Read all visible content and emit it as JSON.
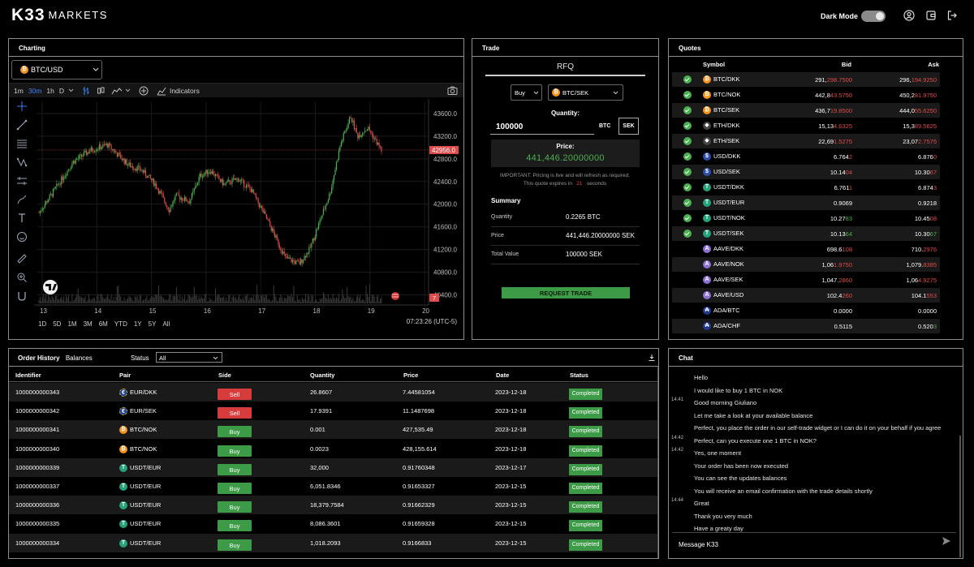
{
  "header": {
    "logo_mark": "K33",
    "logo_word": "MARKETS",
    "dark_mode_label": "Dark Mode",
    "dark_mode_on": true
  },
  "charting": {
    "title": "Charting",
    "pair": "BTC/USD",
    "intervals": [
      "1m",
      "30m",
      "1h",
      "D"
    ],
    "active_interval": "30m",
    "indicators_label": "Indicators",
    "y_ticks": [
      "43600.0",
      "43200.0",
      "42800.0",
      "42400.0",
      "42000.0",
      "41600.0",
      "41200.0",
      "40800.0",
      "40400.0"
    ],
    "x_ticks": [
      "13",
      "14",
      "15",
      "16",
      "17",
      "18",
      "19",
      "20"
    ],
    "current_price": "42956.0",
    "small_marker": "7",
    "ranges": [
      "1D",
      "5D",
      "1M",
      "3M",
      "6M",
      "YTD",
      "1Y",
      "5Y",
      "All"
    ],
    "clock": "07:23:26 (UTC-5)",
    "colors": {
      "up": "#4caf50",
      "down": "#e04b4b",
      "price_tag": "#e04b4b"
    }
  },
  "trade": {
    "title": "Trade",
    "tab": "RFQ",
    "side": "Buy",
    "pair": "BTC/SEK",
    "quantity_label": "Quantity:",
    "quantity": "100000",
    "unit_btc": "BTC",
    "unit_sek": "SEK",
    "price_label": "Price:",
    "price": "441,446.20000000",
    "note_line1": "IMPORTANT: Pricing is live and will refresh as required.",
    "note_prefix": "This quote expires in",
    "expires_seconds": "21",
    "note_suffix": "seconds",
    "summary_title": "Summary",
    "summary": [
      {
        "label": "Quantity",
        "value": "0.2265 BTC"
      },
      {
        "label": "Price",
        "value": "441,446.20000000 SEK"
      },
      {
        "label": "Total Value",
        "value": "100000 SEK"
      }
    ],
    "request_button": "REQUEST TRADE"
  },
  "quotes": {
    "title": "Quotes",
    "headers": {
      "symbol": "Symbol",
      "bid": "Bid",
      "ask": "Ask"
    },
    "rows": [
      {
        "check": true,
        "icon": "btc",
        "symbol": "BTC/DKK",
        "bid_a": "291,",
        "bid_b": "298.7500",
        "bid_c": "hl",
        "ask_a": "296,",
        "ask_b": "194.9250",
        "ask_c": "hl"
      },
      {
        "check": true,
        "icon": "btc",
        "symbol": "BTC/NOK",
        "bid_a": "442,8",
        "bid_b": "43.5750",
        "bid_c": "hl",
        "ask_a": "450,2",
        "ask_b": "81.9750",
        "ask_c": "hl"
      },
      {
        "check": true,
        "icon": "btc",
        "symbol": "BTC/SEK",
        "bid_a": "436,7",
        "bid_b": "19.8500",
        "bid_c": "hl",
        "ask_a": "444,0",
        "ask_b": "55.6250",
        "ask_c": "hl"
      },
      {
        "check": true,
        "icon": "eth",
        "symbol": "ETH/DKK",
        "bid_a": "15,13",
        "bid_b": "4.6325",
        "bid_c": "hl",
        "ask_a": "15,3",
        "ask_b": "89.5625",
        "ask_c": "hl"
      },
      {
        "check": true,
        "icon": "eth",
        "symbol": "ETH/SEK",
        "bid_a": "22,69",
        "bid_b": "1.5275",
        "bid_c": "hl",
        "ask_a": "23,07",
        "ask_b": "2.7575",
        "ask_c": "hl"
      },
      {
        "check": true,
        "icon": "usd",
        "symbol": "USD/DKK",
        "bid_a": "6.764",
        "bid_b": "2",
        "bid_c": "hl",
        "ask_a": "6.876",
        "ask_b": "0",
        "ask_c": "hl"
      },
      {
        "check": true,
        "icon": "usd",
        "symbol": "USD/SEK",
        "bid_a": "10.14",
        "bid_b": "04",
        "bid_c": "hl",
        "ask_a": "10.30",
        "ask_b": "67",
        "ask_c": "hl"
      },
      {
        "check": true,
        "icon": "usdt",
        "symbol": "USDT/DKK",
        "bid_a": "6.761",
        "bid_b": "1",
        "bid_c": "hl",
        "ask_a": "6.874",
        "ask_b": "3",
        "ask_c": "hl"
      },
      {
        "check": true,
        "icon": "usdt",
        "symbol": "USDT/EUR",
        "bid_a": "0.9069",
        "bid_b": "",
        "bid_c": "",
        "ask_a": "0.9218",
        "ask_b": "",
        "ask_c": ""
      },
      {
        "check": true,
        "icon": "usdt",
        "symbol": "USDT/NOK",
        "bid_a": "10.27",
        "bid_b": "83",
        "bid_c": "hg",
        "ask_a": "10.45",
        "ask_b": "08",
        "ask_c": "hl"
      },
      {
        "check": true,
        "icon": "usdt",
        "symbol": "USDT/SEK",
        "bid_a": "10.13",
        "bid_b": "64",
        "bid_c": "hg",
        "ask_a": "10.30",
        "ask_b": "67",
        "ask_c": "hg"
      },
      {
        "check": false,
        "icon": "aave",
        "symbol": "AAVE/DKK",
        "bid_a": "698.6",
        "bid_b": "108",
        "bid_c": "hl",
        "ask_a": "710.",
        "ask_b": "2976",
        "ask_c": "hl"
      },
      {
        "check": false,
        "icon": "aave",
        "symbol": "AAVE/NOK",
        "bid_a": "1,06",
        "bid_b": "1.9750",
        "bid_c": "hl",
        "ask_a": "1,079.",
        "ask_b": "8385",
        "ask_c": "hl"
      },
      {
        "check": false,
        "icon": "aave",
        "symbol": "AAVE/SEK",
        "bid_a": "1,047.",
        "bid_b": "2860",
        "bid_c": "hl",
        "ask_a": "1,06",
        "ask_b": "4.9275",
        "ask_c": "hl"
      },
      {
        "check": false,
        "icon": "aave",
        "symbol": "AAVE/USD",
        "bid_a": "102.4",
        "bid_b": "260",
        "bid_c": "hl",
        "ask_a": "104.1",
        "ask_b": "553",
        "ask_c": "hl"
      },
      {
        "check": false,
        "icon": "ada",
        "symbol": "ADA/BTC",
        "bid_a": "0.0000",
        "bid_b": "",
        "bid_c": "",
        "ask_a": "0.0000",
        "ask_b": "",
        "ask_c": ""
      },
      {
        "check": false,
        "icon": "ada",
        "symbol": "ADA/CHF",
        "bid_a": "0.5115",
        "bid_b": "",
        "bid_c": "",
        "ask_a": "0.520",
        "ask_b": "3",
        "ask_c": "hg"
      }
    ]
  },
  "order_history": {
    "title": "Order History",
    "tab_balances": "Balances",
    "status_label": "Status",
    "status_value": "All",
    "headers": [
      "Identifier",
      "Pair",
      "Side",
      "Quantity",
      "Price",
      "Date",
      "Status"
    ],
    "rows": [
      {
        "id": "1000000000343",
        "icon": "eur",
        "pair": "EUR/DKK",
        "side": "Sell",
        "qty": "26.8607",
        "price": "7.44581054",
        "date": "2023-12-18",
        "status": "Completed"
      },
      {
        "id": "1000000000342",
        "icon": "eur",
        "pair": "EUR/SEK",
        "side": "Sell",
        "qty": "17.9391",
        "price": "11.1487698",
        "date": "2023-12-18",
        "status": "Completed"
      },
      {
        "id": "1000000000341",
        "icon": "btc",
        "pair": "BTC/NOK",
        "side": "Buy",
        "qty": "0.001",
        "price": "427,535.49",
        "date": "2023-12-18",
        "status": "Completed"
      },
      {
        "id": "1000000000340",
        "icon": "btc",
        "pair": "BTC/NOK",
        "side": "Buy",
        "qty": "0.0023",
        "price": "428,155.614",
        "date": "2023-12-18",
        "status": "Completed"
      },
      {
        "id": "1000000000339",
        "icon": "usdt",
        "pair": "USDT/EUR",
        "side": "Buy",
        "qty": "32,000",
        "price": "0.91760348",
        "date": "2023-12-17",
        "status": "Completed"
      },
      {
        "id": "1000000000337",
        "icon": "usdt",
        "pair": "USDT/EUR",
        "side": "Buy",
        "qty": "6,051.8346",
        "price": "0.91653327",
        "date": "2023-12-15",
        "status": "Completed"
      },
      {
        "id": "1000000000336",
        "icon": "usdt",
        "pair": "USDT/EUR",
        "side": "Buy",
        "qty": "18,379.7584",
        "price": "0.91662329",
        "date": "2023-12-15",
        "status": "Completed"
      },
      {
        "id": "1000000000335",
        "icon": "usdt",
        "pair": "USDT/EUR",
        "side": "Buy",
        "qty": "8,086.3601",
        "price": "0.91659328",
        "date": "2023-12-15",
        "status": "Completed"
      },
      {
        "id": "1000000000334",
        "icon": "usdt",
        "pair": "USDT/EUR",
        "side": "Buy",
        "qty": "1,018.2093",
        "price": "0.9166833",
        "date": "2023-12-15",
        "status": "Completed"
      }
    ]
  },
  "chat": {
    "title": "Chat",
    "messages": [
      {
        "time": "",
        "text": "Hello"
      },
      {
        "time": "",
        "text": "I would like to buy 1 BTC in NOK"
      },
      {
        "time": "14:41",
        "text": "Good morning Giuliano"
      },
      {
        "time": "",
        "text": "Let me take a look at your available balance"
      },
      {
        "time": "",
        "text": "Perfect, you place the order in our self-trade widget or I can do it on your behalf if you agree"
      },
      {
        "time": "14:42",
        "text": "Perfect, can you execute one 1 BTC in NOK?"
      },
      {
        "time": "14:42",
        "text": "Yes, one moment"
      },
      {
        "time": "",
        "text": "Your order has been now executed"
      },
      {
        "time": "",
        "text": "You can see the updates balances"
      },
      {
        "time": "",
        "text": "You will receive an email confirmation with the trade details shortly"
      },
      {
        "time": "14:44",
        "text": "Great"
      },
      {
        "time": "",
        "text": "Thank you very much"
      },
      {
        "time": "",
        "text": "Have a greaty day"
      }
    ],
    "input_placeholder": "Message K33"
  }
}
